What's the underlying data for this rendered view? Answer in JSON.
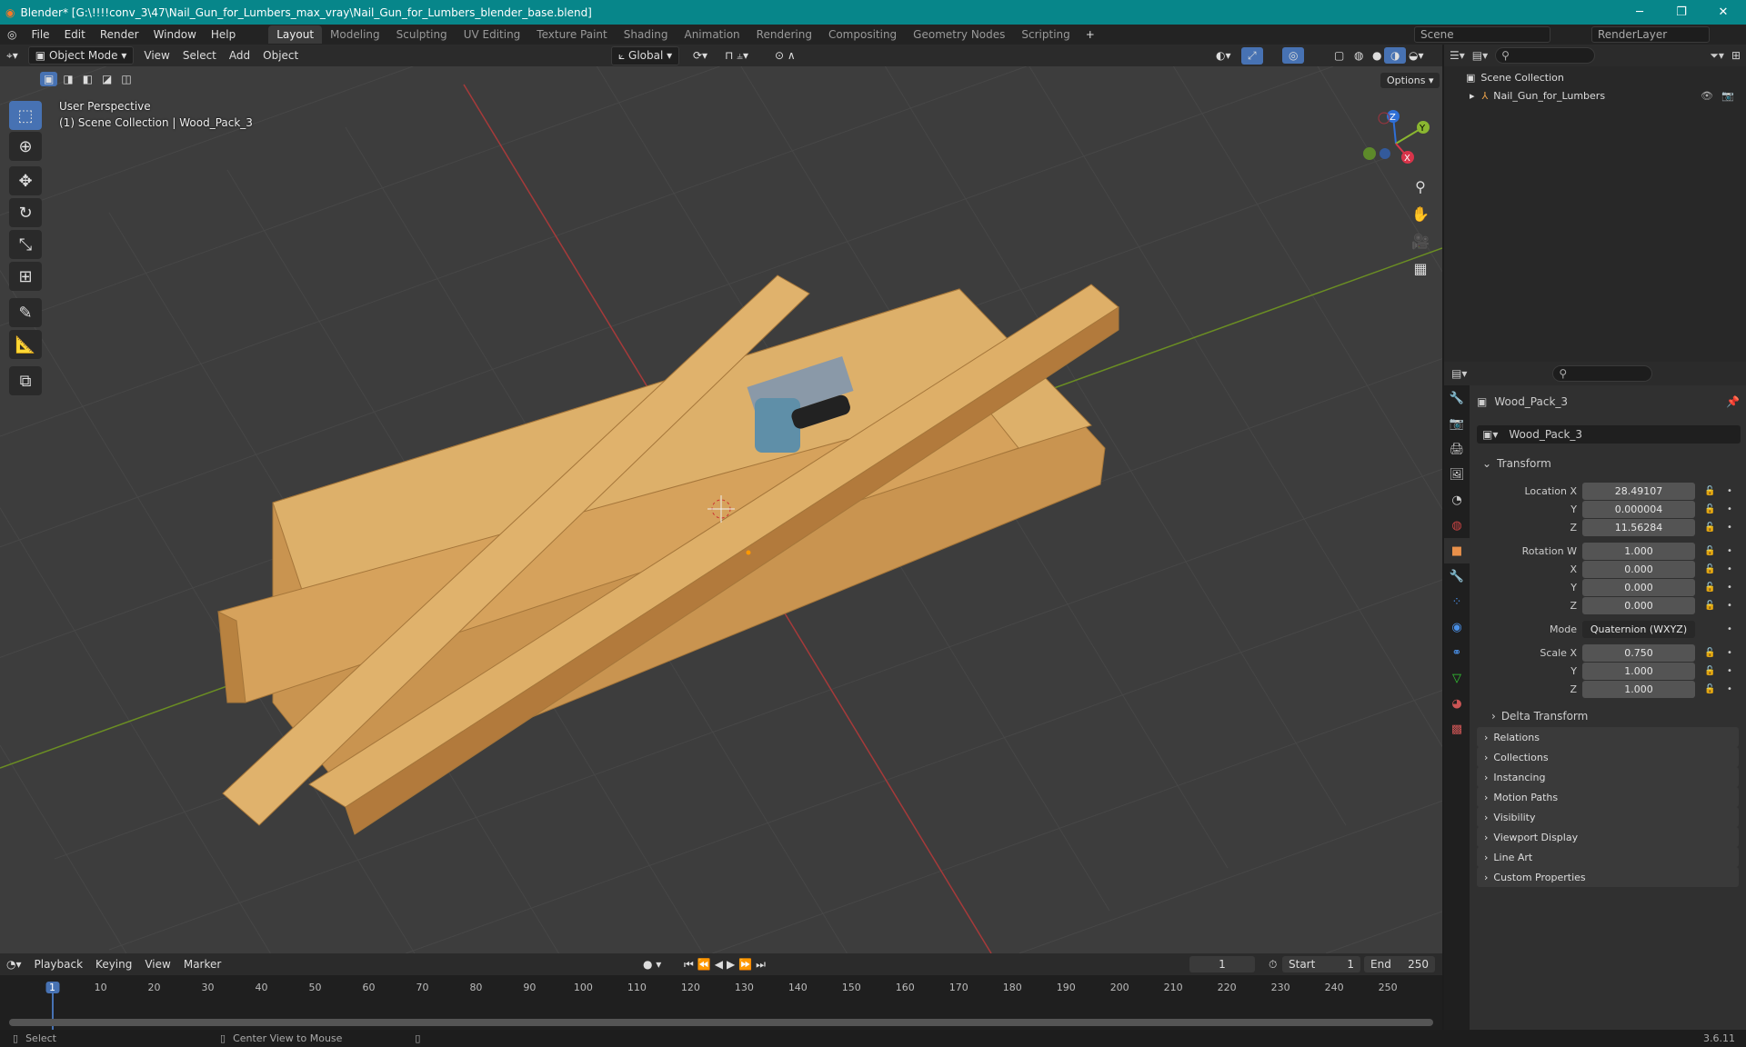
{
  "window": {
    "title": "Blender* [G:\\!!!!conv_3\\47\\Nail_Gun_for_Lumbers_max_vray\\Nail_Gun_for_Lumbers_blender_base.blend]"
  },
  "menus": [
    "File",
    "Edit",
    "Render",
    "Window",
    "Help"
  ],
  "workspaces": [
    "Layout",
    "Modeling",
    "Sculpting",
    "UV Editing",
    "Texture Paint",
    "Shading",
    "Animation",
    "Rendering",
    "Compositing",
    "Geometry Nodes",
    "Scripting"
  ],
  "active_workspace": "Layout",
  "scene": {
    "name": "Scene",
    "view_layer": "RenderLayer"
  },
  "viewport_header": {
    "mode": "Object Mode",
    "menus": [
      "View",
      "Select",
      "Add",
      "Object"
    ],
    "orientation": "Global",
    "options": "Options"
  },
  "viewport": {
    "view_name": "User Perspective",
    "context": "(1) Scene Collection | Wood_Pack_3",
    "colors": {
      "x_axis": "#a63a3a",
      "y_axis": "#6b8e23",
      "wood": "#d9a55a"
    }
  },
  "gizmo": {
    "x": "X",
    "y": "Y",
    "z": "Z"
  },
  "outliner": {
    "root": "Scene Collection",
    "items": [
      {
        "name": "Nail_Gun_for_Lumbers"
      }
    ]
  },
  "properties": {
    "object_name": "Wood_Pack_3",
    "data_name": "Wood_Pack_3",
    "transform_label": "Transform",
    "location": {
      "label": "Location X",
      "x": "28.49107",
      "y": "0.000004",
      "z": "11.56284"
    },
    "rotation": {
      "label": "Rotation W",
      "w": "1.000",
      "x": "0.000",
      "y": "0.000",
      "z": "0.000"
    },
    "mode": {
      "label": "Mode",
      "value": "Quaternion (WXYZ)"
    },
    "scale": {
      "label": "Scale X",
      "x": "0.750",
      "y": "1.000",
      "z": "1.000"
    },
    "axis": {
      "y": "Y",
      "z": "Z",
      "x": "X"
    },
    "delta": "Delta Transform",
    "sections": [
      "Relations",
      "Collections",
      "Instancing",
      "Motion Paths",
      "Visibility",
      "Viewport Display",
      "Line Art",
      "Custom Properties"
    ]
  },
  "timeline": {
    "menus": [
      "Playback",
      "Keying",
      "View",
      "Marker"
    ],
    "current_frame": "1",
    "start_label": "Start",
    "start": "1",
    "end_label": "End",
    "end": "250",
    "ticks": [
      1,
      10,
      20,
      30,
      40,
      50,
      60,
      70,
      80,
      90,
      100,
      110,
      120,
      130,
      140,
      150,
      160,
      170,
      180,
      190,
      200,
      210,
      220,
      230,
      240,
      250
    ]
  },
  "status": {
    "select": "Select",
    "center": "Center View to Mouse",
    "version": "3.6.11"
  }
}
